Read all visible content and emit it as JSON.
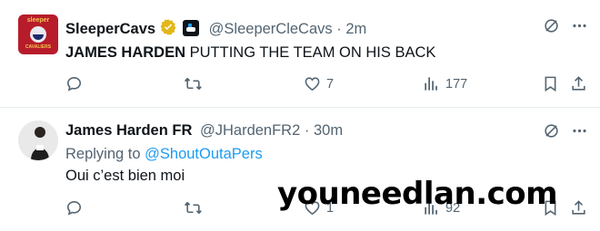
{
  "tweets": [
    {
      "display_name": "SleeperCavs",
      "handle": "@SleeperCleCavs",
      "separator": "·",
      "time": "2m",
      "avatar_text_top": "sleeper",
      "avatar_text_bottom": "CAVALIERS",
      "text_bold": "JAMES HARDEN",
      "text_rest": " PUTTING THE TEAM ON HIS BACK",
      "likes": "7",
      "views": "177"
    },
    {
      "display_name": "James Harden FR",
      "handle": "@JHardenFR2",
      "separator": "·",
      "time": "30m",
      "replying_prefix": "Replying to ",
      "replying_to": "@ShoutOutaPers",
      "text": "Oui c’est bien moi",
      "likes": "1",
      "views": "92"
    }
  ],
  "watermark": "youneedlan.com",
  "colors": {
    "text": "#0f1419",
    "muted": "#536471",
    "link": "#1d9bf0",
    "verified_gold": "#e2b719",
    "divider": "#e6ecf0"
  },
  "icons": [
    "reply-icon",
    "retweet-icon",
    "like-icon",
    "views-icon",
    "bookmark-icon",
    "share-icon",
    "grok-icon",
    "more-icon",
    "verified-icon",
    "affiliate-badge-icon"
  ]
}
